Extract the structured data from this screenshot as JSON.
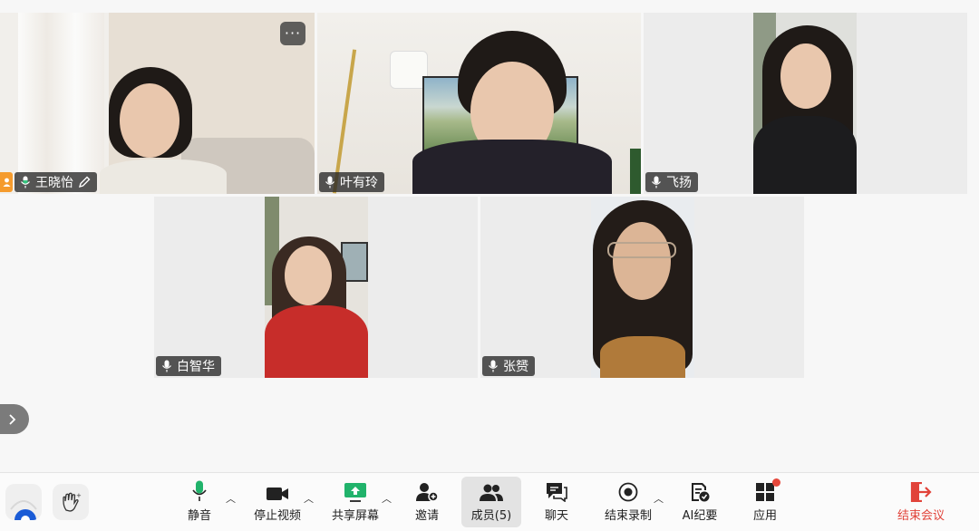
{
  "participants": [
    {
      "name": "王晓怡",
      "role": "host",
      "speaking": true
    },
    {
      "name": "叶有玲"
    },
    {
      "name": "飞扬"
    },
    {
      "name": "白智华"
    },
    {
      "name": "张赟"
    }
  ],
  "tile_menu_label": "···",
  "toolbar": {
    "mute": "静音",
    "stop_video": "停止视频",
    "share_screen": "共享屏幕",
    "invite": "邀请",
    "members": "成员(5)",
    "chat": "聊天",
    "stop_recording": "结束录制",
    "ai_minutes": "AI纪要",
    "apps": "应用",
    "end_meeting": "结束会议"
  },
  "icons": {
    "mic": "mic-icon",
    "video": "video-camera-icon",
    "share": "share-screen-icon",
    "invite": "add-person-icon",
    "members": "members-icon",
    "chat": "chat-icon",
    "record": "record-stop-icon",
    "ai": "ai-notes-icon",
    "apps": "apps-grid-icon",
    "end": "exit-icon",
    "raise_hand": "raise-hand-icon"
  },
  "colors": {
    "active_speaker_border": "#3cc48a",
    "end_meeting": "#e1433a",
    "mic_active": "#21b36b",
    "share_active": "#21b36b",
    "apps_badge": "#e5473b"
  }
}
